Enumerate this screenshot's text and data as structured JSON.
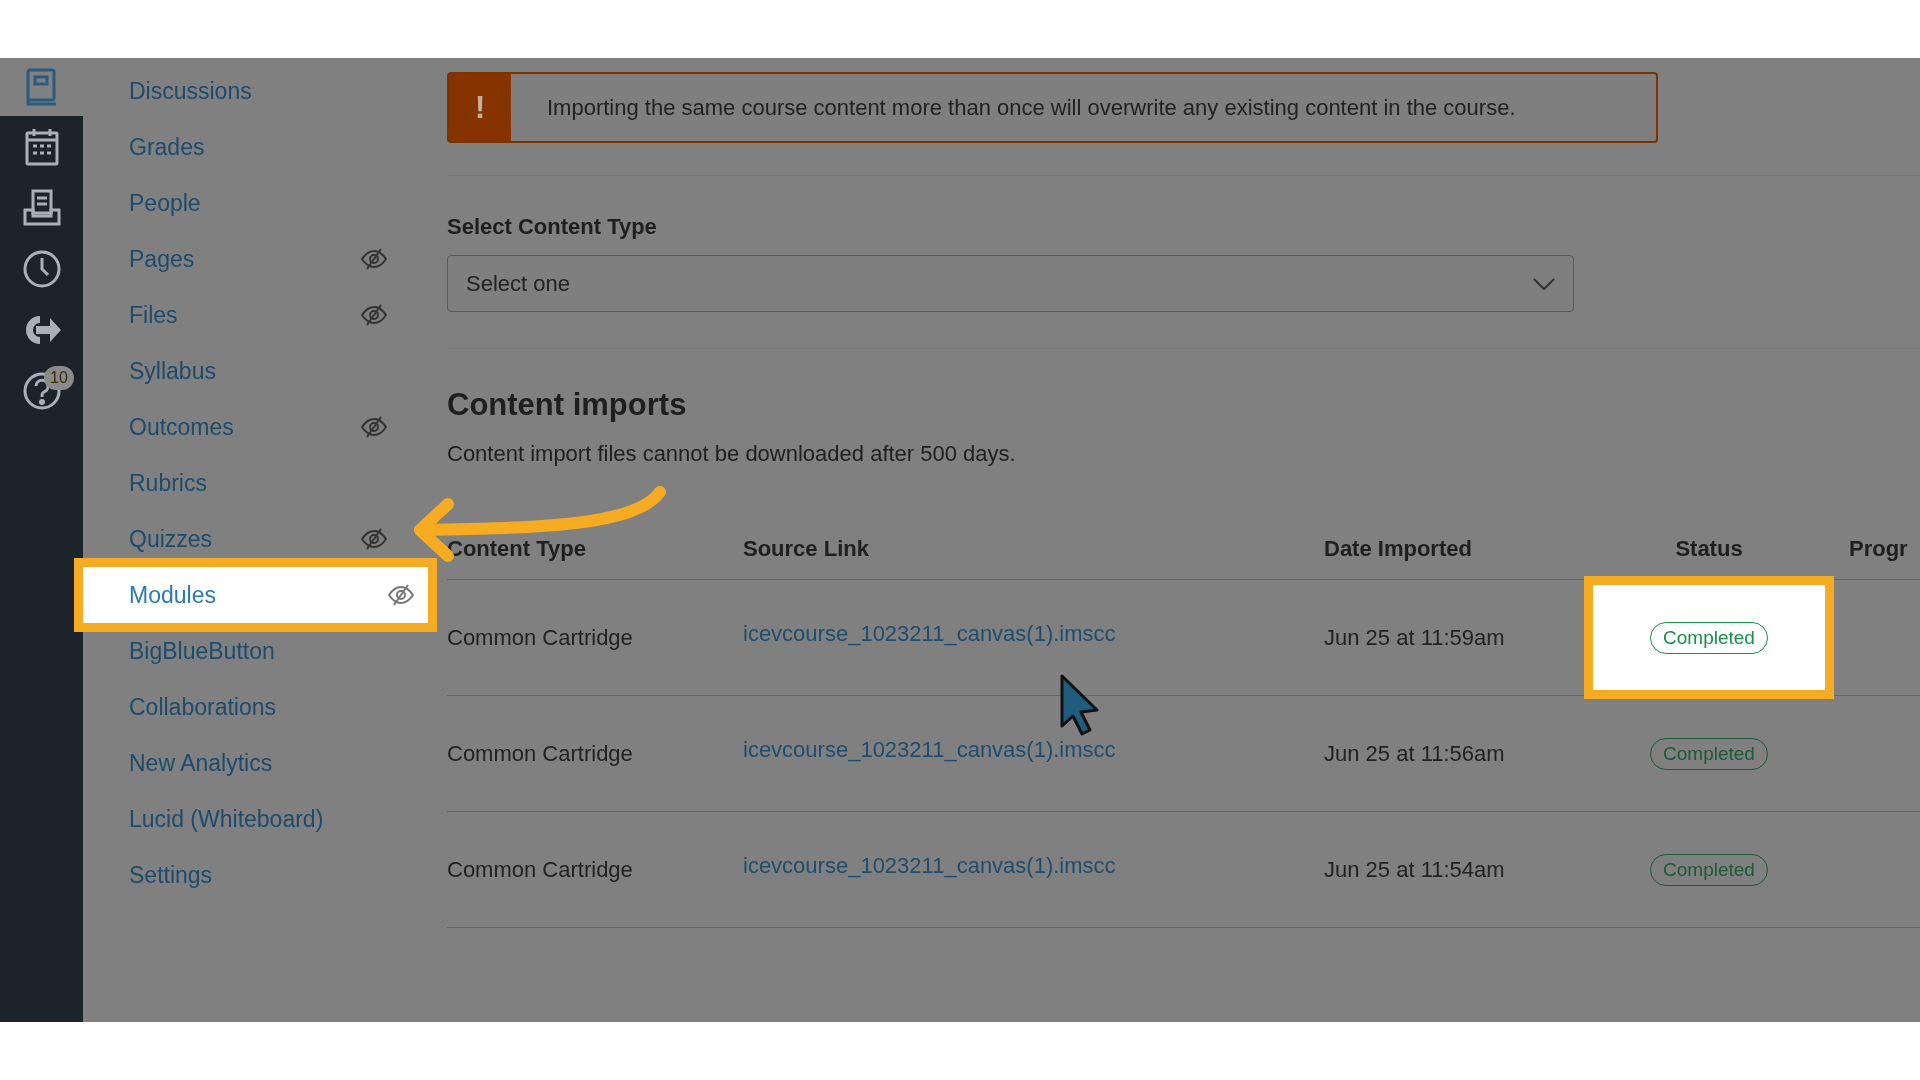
{
  "global_nav": {
    "items": [
      {
        "kind": "courses",
        "selected": true
      },
      {
        "kind": "calendar",
        "selected": false
      },
      {
        "kind": "inbox",
        "selected": false
      },
      {
        "kind": "history",
        "selected": false
      },
      {
        "kind": "commons",
        "selected": false
      },
      {
        "kind": "help",
        "selected": false,
        "badge": "10"
      }
    ]
  },
  "course_nav": {
    "items": [
      {
        "label": "Discussions",
        "hidden": false,
        "highlighted": false
      },
      {
        "label": "Grades",
        "hidden": false,
        "highlighted": false
      },
      {
        "label": "People",
        "hidden": false,
        "highlighted": false
      },
      {
        "label": "Pages",
        "hidden": true,
        "highlighted": false
      },
      {
        "label": "Files",
        "hidden": true,
        "highlighted": false
      },
      {
        "label": "Syllabus",
        "hidden": false,
        "highlighted": false
      },
      {
        "label": "Outcomes",
        "hidden": true,
        "highlighted": false
      },
      {
        "label": "Rubrics",
        "hidden": false,
        "highlighted": false
      },
      {
        "label": "Quizzes",
        "hidden": true,
        "highlighted": false
      },
      {
        "label": "Modules",
        "hidden": true,
        "highlighted": true
      },
      {
        "label": "BigBlueButton",
        "hidden": false,
        "highlighted": false
      },
      {
        "label": "Collaborations",
        "hidden": false,
        "highlighted": false
      },
      {
        "label": "New Analytics",
        "hidden": false,
        "highlighted": false
      },
      {
        "label": "Lucid (Whiteboard)",
        "hidden": false,
        "highlighted": false
      },
      {
        "label": "Settings",
        "hidden": false,
        "highlighted": false
      }
    ]
  },
  "warning": {
    "icon": "!",
    "text": "Importing the same course content more than once will overwrite any existing content in the course."
  },
  "content_type": {
    "label": "Select Content Type",
    "value": "Select one"
  },
  "imports": {
    "heading": "Content imports",
    "note": "Content import files cannot be downloaded after 500 days.",
    "table": {
      "columns": [
        "Content Type",
        "Source Link",
        "Date Imported",
        "Status",
        "Progr"
      ],
      "rows": [
        {
          "content_type": "Common Cartridge",
          "source_link": "icevcourse_1023211_canvas(1).imscc",
          "date_imported": "Jun 25 at 11:59am",
          "status": "Completed",
          "highlighted": true
        },
        {
          "content_type": "Common Cartridge",
          "source_link": "icevcourse_1023211_canvas(1).imscc",
          "date_imported": "Jun 25 at 11:56am",
          "status": "Completed",
          "highlighted": false
        },
        {
          "content_type": "Common Cartridge",
          "source_link": "icevcourse_1023211_canvas(1).imscc",
          "date_imported": "Jun 25 at 11:54am",
          "status": "Completed",
          "highlighted": false
        }
      ]
    }
  }
}
